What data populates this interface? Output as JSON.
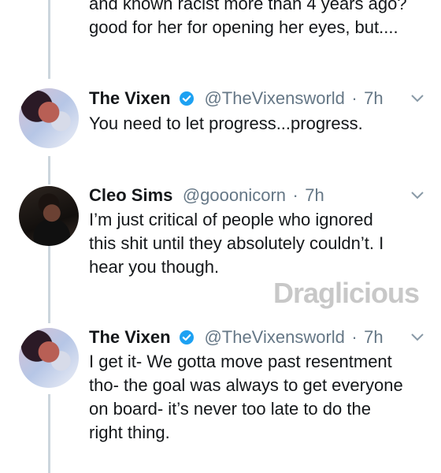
{
  "tweets": [
    {
      "partial_lines": [
        "and known racist more than 4 years ago?",
        "good for her for opening her eyes, but...."
      ]
    },
    {
      "name": "The Vixen",
      "handle": "@TheVixensworld",
      "separator": "·",
      "time": "7h",
      "text": "You need to let progress...progress.",
      "verified": true
    },
    {
      "name": "Cleo Sims",
      "handle": "@gooonicorn",
      "separator": "·",
      "time": "7h",
      "lines": [
        "I’m just critical of people who ignored",
        "this shit until they absolutely couldn’t. I",
        "hear you though."
      ],
      "verified": false
    },
    {
      "name": "The Vixen",
      "handle": "@TheVixensworld",
      "separator": "·",
      "time": "7h",
      "lines": [
        "I get it- We gotta move past resentment",
        "tho- the goal was always to get everyone",
        "on board- it’s never too late to do the",
        "right thing."
      ],
      "verified": true
    }
  ],
  "watermark": "Draglicious",
  "colors": {
    "verified": "#1da1f2",
    "muted": "#657786",
    "thread": "#ccd6dd"
  },
  "icons": {
    "verified": "verified-badge-icon",
    "caret": "chevron-down-icon"
  }
}
